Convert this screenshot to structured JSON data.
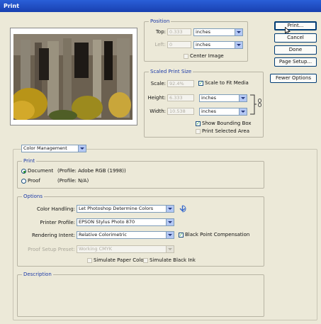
{
  "window": {
    "title": "Print"
  },
  "position": {
    "legend": "Position",
    "top_label": "Top:",
    "top_value": "0.333",
    "top_unit": "inches",
    "left_label": "Left:",
    "left_value": "0",
    "left_unit": "inches",
    "center_label": "Center Image"
  },
  "scaled": {
    "legend": "Scaled Print Size",
    "scale_label": "Scale:",
    "scale_value": "92.4%",
    "fit_label": "Scale to Fit Media",
    "height_label": "Height:",
    "height_value": "6.333",
    "height_unit": "inches",
    "width_label": "Width:",
    "width_value": "10.538",
    "width_unit": "inches",
    "bounding_label": "Show Bounding Box",
    "selected_label": "Print Selected Area"
  },
  "buttons": {
    "print": "Print...",
    "cancel": "Cancel",
    "done": "Done",
    "page_setup": "Page Setup...",
    "fewer": "Fewer Options"
  },
  "mode": {
    "selected": "Color Management"
  },
  "print_group": {
    "legend": "Print",
    "document_label": "Document",
    "document_profile": "(Profile: Adobe RGB (1998))",
    "proof_label": "Proof",
    "proof_profile": "(Profile: N/A)"
  },
  "options": {
    "legend": "Options",
    "color_handling_label": "Color Handling:",
    "color_handling_value": "Let Photoshop Determine Colors",
    "printer_profile_label": "Printer Profile:",
    "printer_profile_value": "EPSON Stylus Photo 870",
    "intent_label": "Rendering Intent:",
    "intent_value": "Relative Colorimetric",
    "bpc_label": "Black Point Compensation",
    "proof_setup_label": "Proof Setup Preset:",
    "proof_setup_value": "Working CMYK",
    "simulate_paper_label": "Simulate Paper Color",
    "simulate_ink_label": "Simulate Black Ink"
  },
  "description": {
    "legend": "Description"
  },
  "colors": {
    "title_blue": "#1f4fc8",
    "legend_blue": "#1c3aa8",
    "dialog_bg": "#ece9d8"
  }
}
